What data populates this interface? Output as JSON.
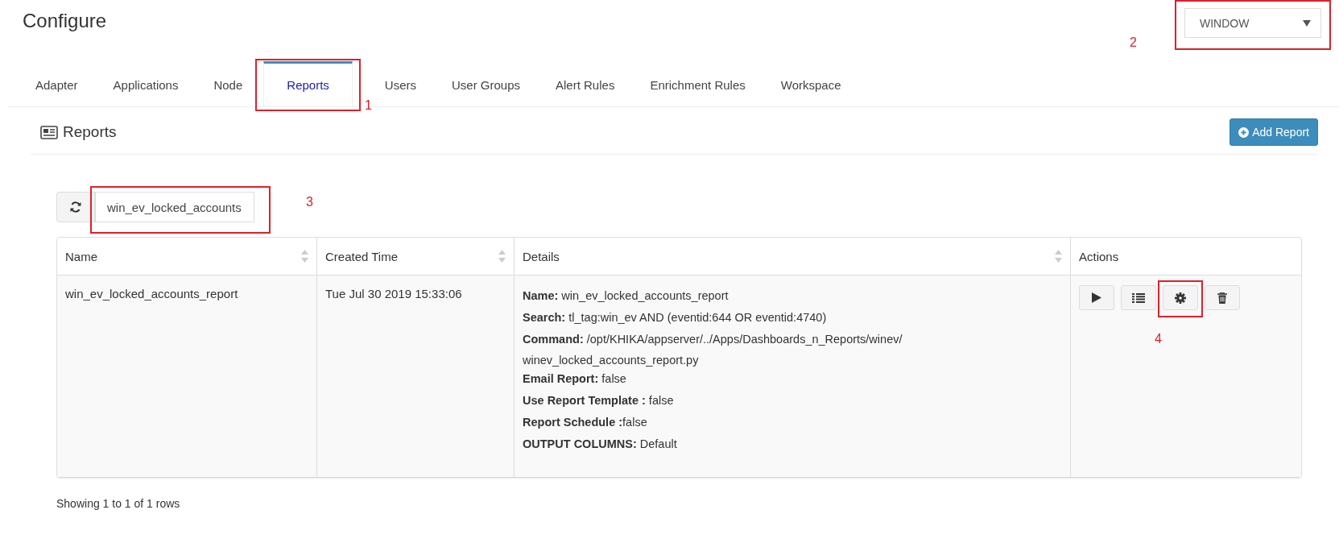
{
  "page_title": "Configure",
  "scope_dropdown": {
    "value": "WINDOW",
    "annotation": "2"
  },
  "tabs": [
    {
      "label": "Adapter",
      "selected": false
    },
    {
      "label": "Applications",
      "selected": false
    },
    {
      "label": "Node",
      "selected": false
    },
    {
      "label": "Reports",
      "selected": true,
      "annotation": "1"
    },
    {
      "label": "Users",
      "selected": false
    },
    {
      "label": "User Groups",
      "selected": false
    },
    {
      "label": "Alert Rules",
      "selected": false
    },
    {
      "label": "Enrichment Rules",
      "selected": false
    },
    {
      "label": "Workspace",
      "selected": false
    }
  ],
  "section": {
    "title": "Reports",
    "add_button": "Add Report"
  },
  "search": {
    "value": "win_ev_locked_accounts",
    "annotation": "3"
  },
  "table": {
    "columns": [
      {
        "label": "Name",
        "sortable": true
      },
      {
        "label": "Created Time",
        "sortable": true
      },
      {
        "label": "Details",
        "sortable": true
      },
      {
        "label": "Actions",
        "sortable": false
      }
    ],
    "rows": [
      {
        "name": "win_ev_locked_accounts_report",
        "created_time": "Tue Jul 30 2019 15:33:06",
        "details": [
          {
            "kind": "line",
            "text": "**Name:** win_ev_locked_accounts_report"
          },
          {
            "kind": "line",
            "text": "**Search:** tl_tag:win_ev AND (eventid:644 OR eventid:4740)"
          },
          {
            "kind": "line",
            "text": "**Command:** /opt/KHIKA/appserver/../Apps/Dashboards_n_Reports/winev/"
          },
          {
            "kind": "continuation",
            "text": "winev_locked_accounts_report.py"
          },
          {
            "kind": "line",
            "text": "**Email Report:** false"
          },
          {
            "kind": "line",
            "text": "**Use Report Template :** false"
          },
          {
            "kind": "line",
            "text": "**Report Schedule :**false"
          },
          {
            "kind": "line",
            "text": "**OUTPUT COLUMNS:** Default"
          }
        ],
        "actions": [
          {
            "kind": "play"
          },
          {
            "kind": "list"
          },
          {
            "kind": "gear",
            "annotation": "4"
          },
          {
            "kind": "trash"
          }
        ]
      }
    ]
  },
  "footer": "Showing 1 to 1 of 1 rows"
}
